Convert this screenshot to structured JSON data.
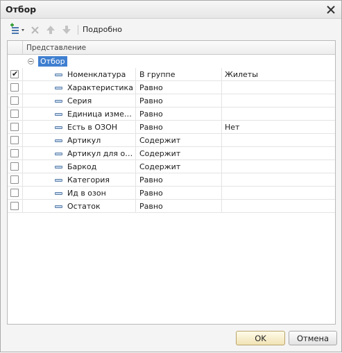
{
  "window": {
    "title": "Отбор"
  },
  "toolbar": {
    "details_label": "Подробно"
  },
  "grid": {
    "header": {
      "representation": "Представление"
    },
    "group_label": "Отбор",
    "rows": [
      {
        "field": "Номенклатура",
        "condition": "В группе",
        "value": "Жилеты",
        "checked": true
      },
      {
        "field": "Характеристика",
        "condition": "Равно",
        "value": "",
        "checked": false
      },
      {
        "field": "Серия",
        "condition": "Равно",
        "value": "",
        "checked": false
      },
      {
        "field": "Единица измере…",
        "condition": "Равно",
        "value": "",
        "checked": false
      },
      {
        "field": "Есть в ОЗОН",
        "condition": "Равно",
        "value": "Нет",
        "checked": false
      },
      {
        "field": "Артикул",
        "condition": "Содержит",
        "value": "",
        "checked": false
      },
      {
        "field": "Артикул для озон",
        "condition": "Содержит",
        "value": "",
        "checked": false
      },
      {
        "field": "Баркод",
        "condition": "Содержит",
        "value": "",
        "checked": false
      },
      {
        "field": "Категория",
        "condition": "Равно",
        "value": "",
        "checked": false
      },
      {
        "field": "Ид в озон",
        "condition": "Равно",
        "value": "",
        "checked": false
      },
      {
        "field": "Остаток",
        "condition": "Равно",
        "value": "",
        "checked": false
      }
    ]
  },
  "footer": {
    "ok_label": "OK",
    "cancel_label": "Отмена"
  },
  "colors": {
    "selection": "#3f7fd0",
    "ok_button": "#f1e3b5"
  }
}
